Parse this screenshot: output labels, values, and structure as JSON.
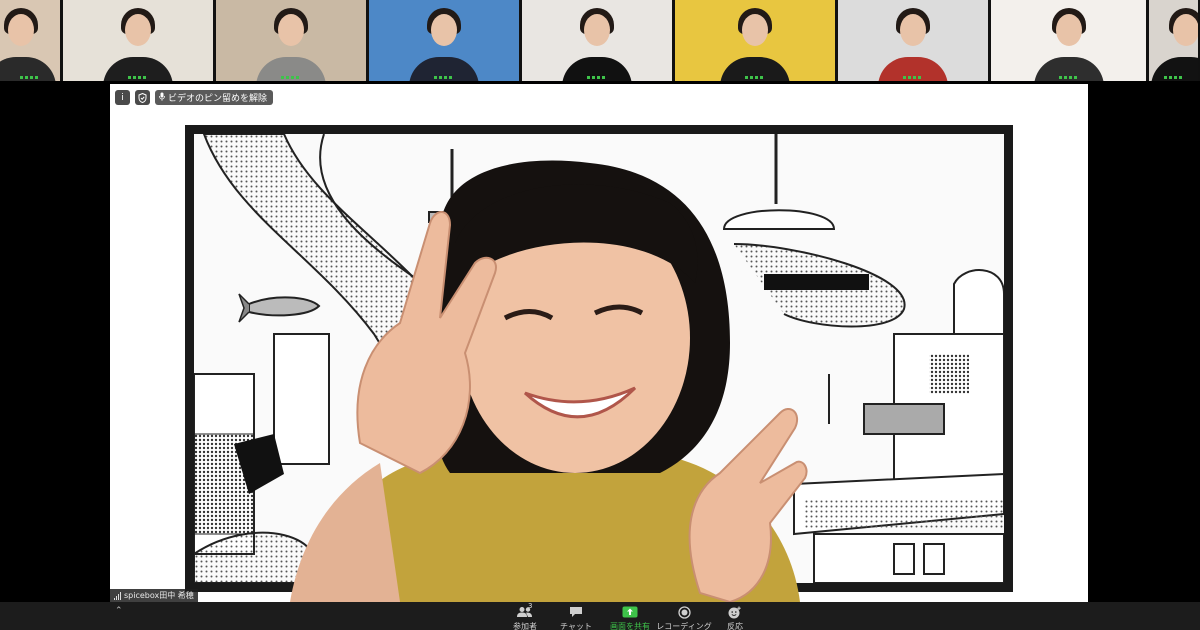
{
  "gallery": {
    "tiles": [
      {
        "id": "p1",
        "w": 60,
        "bg": "#d9c7b3",
        "shirt": "#2a2a2a"
      },
      {
        "id": "p2",
        "w": 150,
        "bg": "#e6e1d8",
        "shirt": "#1e1e1e"
      },
      {
        "id": "p3",
        "w": 150,
        "bg": "#c9b9a4",
        "shirt": "#8a8a88"
      },
      {
        "id": "p4",
        "w": 150,
        "bg": "#4d88c7",
        "shirt": "#1f2433"
      },
      {
        "id": "p5",
        "w": 150,
        "bg": "#e9e6e2",
        "shirt": "#111111"
      },
      {
        "id": "p6",
        "w": 160,
        "bg": "#e8c640",
        "shirt": "#1a1a1a"
      },
      {
        "id": "p7",
        "w": 150,
        "bg": "#dcdcdc",
        "shirt": "#b2322b"
      },
      {
        "id": "p8",
        "w": 155,
        "bg": "#f3f0ec",
        "shirt": "#2e2e2e"
      },
      {
        "id": "p9",
        "w": 49,
        "bg": "#d9d4ce",
        "shirt": "#121212"
      }
    ]
  },
  "share": {
    "unpin_label": "ビデオのピン留めを解除"
  },
  "speaker": {
    "name_label": "spicebox田中 希穂"
  },
  "controls": {
    "participants_count": "3",
    "items": [
      {
        "key": "participants",
        "label": "参加者"
      },
      {
        "key": "chat",
        "label": "チャット"
      },
      {
        "key": "share",
        "label": "画面を共有"
      },
      {
        "key": "record",
        "label": "レコーディング"
      },
      {
        "key": "reactions",
        "label": "反応"
      }
    ]
  },
  "colors": {
    "accent_green": "#3ec34a",
    "toolbar_bg": "#1c1c1c",
    "frame_border": "#1a1a1a",
    "shirt_mustard": "#c2a33c"
  }
}
